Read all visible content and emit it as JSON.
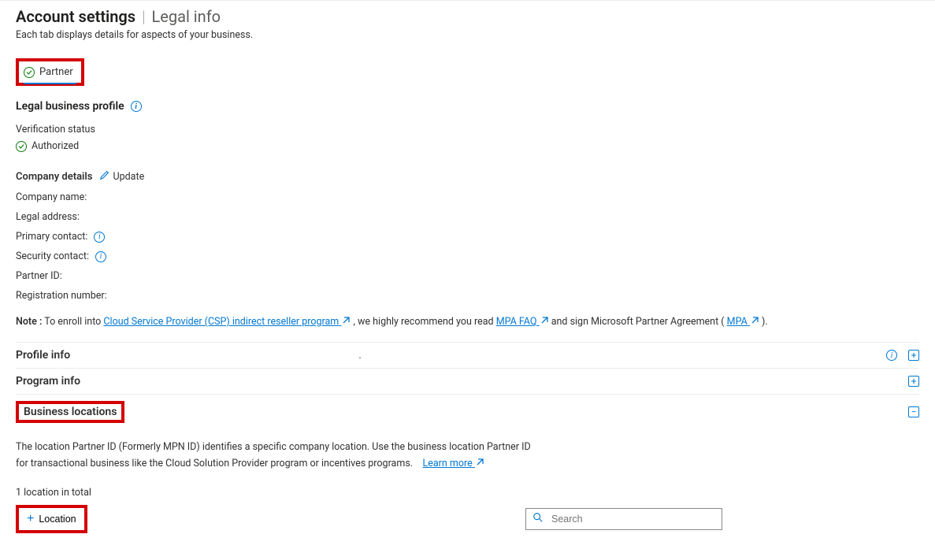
{
  "header": {
    "title": "Account settings",
    "separator": "|",
    "subtitle": "Legal info",
    "description": "Each tab displays details for aspects of your business."
  },
  "tab": {
    "partner_label": "Partner"
  },
  "legal_profile": {
    "heading": "Legal business profile",
    "verification_label": "Verification status",
    "verification_value": "Authorized",
    "company_details_label": "Company details",
    "update_label": "Update",
    "fields": {
      "company_name": "Company name:",
      "legal_address": "Legal address:",
      "primary_contact": "Primary contact:",
      "security_contact": "Security contact:",
      "partner_id": "Partner ID:",
      "registration_number": "Registration number:"
    },
    "note_bold": "Note :",
    "note_1": " To enroll into ",
    "note_link_csp": "Cloud Service Provider (CSP) indirect reseller program",
    "note_2": " , we highly recommend you read ",
    "note_link_faq": "MPA FAQ",
    "note_3": " and sign Microsoft Partner Agreement ( ",
    "note_link_mpa": "MPA",
    "note_4": " )."
  },
  "accordion": {
    "profile_info": "Profile info",
    "profile_dot": ".",
    "program_info": "Program info",
    "business_locations": "Business locations"
  },
  "business": {
    "desc_line1": "The location Partner ID (Formerly MPN ID) identifies a specific company location. Use the business location Partner ID",
    "desc_line2": "for transactional business like the Cloud Solution Provider program or incentives programs.",
    "learn_more": "Learn more",
    "total": "1 location in total",
    "location_btn": "Location"
  },
  "search": {
    "placeholder": "Search"
  }
}
